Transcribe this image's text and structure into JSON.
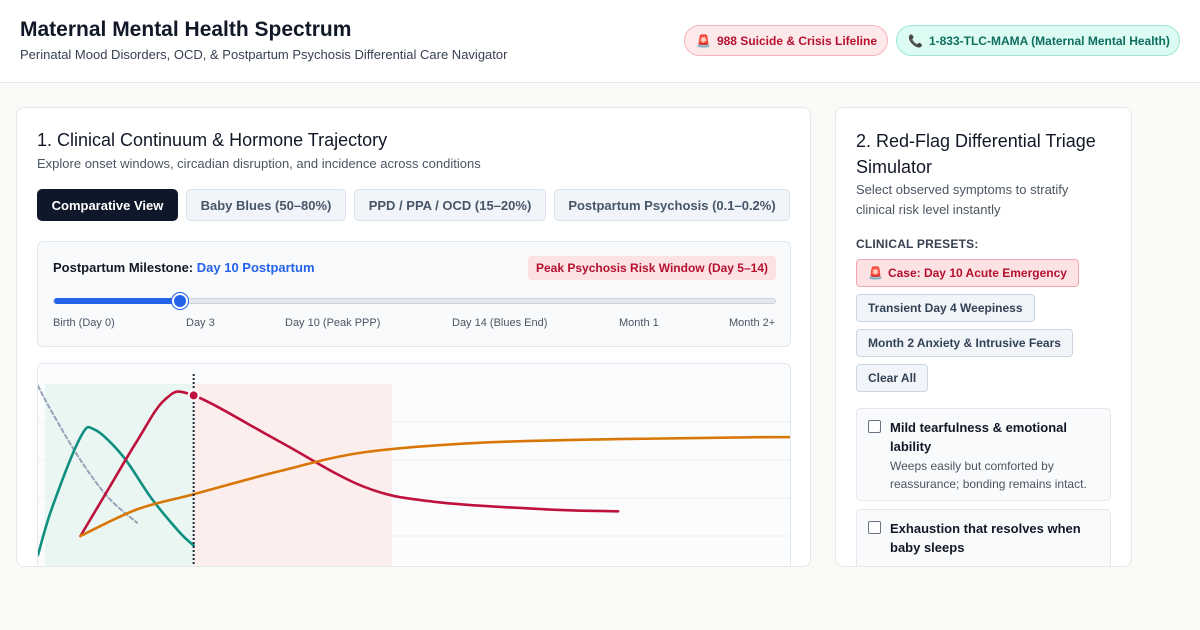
{
  "header": {
    "title": "Maternal Mental Health Spectrum",
    "subtitle": "Perinatal Mood Disorders, OCD, & Postpartum Psychosis Differential Care Navigator",
    "hotlines": [
      {
        "icon": "siren-icon",
        "label": "988 Suicide & Crisis Lifeline",
        "color": "#b4112f"
      },
      {
        "icon": "phone-icon",
        "label": "1-833-TLC-MAMA (Maternal Mental Health)",
        "color": "#0f6f5f"
      }
    ]
  },
  "continuum": {
    "title": "1. Clinical Continuum & Hormone Trajectory",
    "subtitle": "Explore onset windows, circadian disruption, and incidence across conditions",
    "tabs": [
      {
        "label": "Comparative View",
        "active": true
      },
      {
        "label": "Baby Blues (50–80%)",
        "active": false
      },
      {
        "label": "PPD / PPA / OCD (15–20%)",
        "active": false
      },
      {
        "label": "Postpartum Psychosis (0.1–0.2%)",
        "active": false
      }
    ],
    "milestone": {
      "label": "Postpartum Milestone:",
      "value": "Day 10 Postpartum",
      "risk_badge": "Peak Psychosis Risk Window (Day 5–14)",
      "slider_fraction": 0.174,
      "ticks": [
        "Birth (Day 0)",
        "Day 3",
        "Day 10 (Peak PPP)",
        "Day 14 (Blues End)",
        "Month 1",
        "Month 2+"
      ]
    }
  },
  "chart_data": {
    "type": "line",
    "title": "",
    "xlabel": "",
    "ylabel": "",
    "x_unit": "days postpartum",
    "xlim": [
      -1,
      60
    ],
    "ylim": [
      0,
      100
    ],
    "grid": true,
    "marker_day": 10,
    "series": [
      {
        "key": "hormone",
        "color": "#94a3b8",
        "dashed": true,
        "points": [
          [
            -1,
            99
          ],
          [
            0,
            85
          ],
          [
            2,
            60
          ],
          [
            4,
            40
          ],
          [
            6,
            27
          ]
        ]
      },
      {
        "key": "blues",
        "color": "#0f8f80",
        "points": [
          [
            -1,
            10
          ],
          [
            0,
            35
          ],
          [
            2,
            72
          ],
          [
            3,
            76
          ],
          [
            5,
            62
          ],
          [
            7,
            40
          ],
          [
            9,
            22
          ],
          [
            10,
            15
          ]
        ]
      },
      {
        "key": "psychosis",
        "color": "#be123c",
        "points": [
          [
            2,
            20
          ],
          [
            4,
            45
          ],
          [
            6,
            70
          ],
          [
            8,
            92
          ],
          [
            10,
            94
          ],
          [
            16,
            70
          ],
          [
            22,
            46
          ],
          [
            27,
            38
          ],
          [
            35,
            34
          ],
          [
            40,
            33
          ]
        ]
      },
      {
        "key": "ppd",
        "color": "#d97706",
        "points": [
          [
            2,
            20
          ],
          [
            6,
            34
          ],
          [
            10,
            42
          ],
          [
            16,
            54
          ],
          [
            22,
            64
          ],
          [
            30,
            69
          ],
          [
            40,
            71
          ],
          [
            50,
            72
          ],
          [
            60,
            72
          ]
        ]
      }
    ],
    "bands": [
      {
        "from": -0.5,
        "to": 10,
        "color": "#e9f6f2"
      },
      {
        "from": 10,
        "to": 24,
        "color": "#fdeeee"
      }
    ]
  },
  "triage": {
    "title": "2. Red-Flag Differential Triage Simulator",
    "subtitle": "Select observed symptoms to stratify clinical risk level instantly",
    "presets_label": "CLINICAL PRESETS:",
    "presets": [
      {
        "icon": "siren-icon",
        "label": "Case: Day 10 Acute Emergency",
        "style": "red"
      },
      {
        "label": "Transient Day 4 Weepiness",
        "style": "idle"
      },
      {
        "label": "Month 2 Anxiety & Intrusive Fears",
        "style": "idle"
      },
      {
        "label": "Clear All",
        "style": "idle"
      }
    ],
    "symptoms": [
      {
        "title": "Mild tearfulness & emotional lability",
        "desc": "Weeps easily but comforted by reassurance; bonding remains intact.",
        "checked": false
      },
      {
        "title": "Exhaustion that resolves when baby sleeps",
        "desc": "",
        "checked": false
      }
    ]
  }
}
